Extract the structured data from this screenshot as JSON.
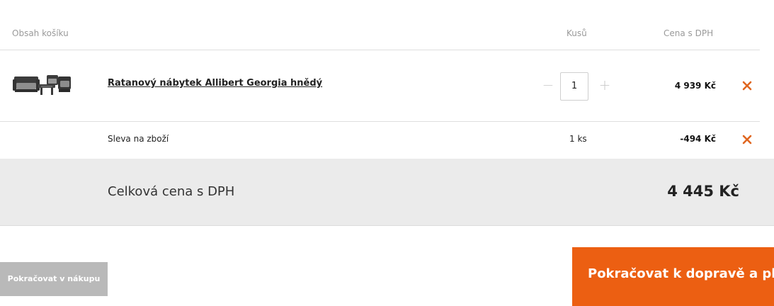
{
  "header": {
    "col_content": "Obsah košíku",
    "col_qty": "Kusů",
    "col_price": "Cena s DPH"
  },
  "item": {
    "name": "Ratanový nábytek Allibert Georgia hnědý",
    "quantity": "1",
    "minus_symbol": "−",
    "plus_symbol": "+",
    "price": "4 939 Kč",
    "image_icon": "rattan-furniture-set-thumbnail",
    "remove_icon": "close-icon"
  },
  "discount": {
    "label": "Sleva na zboží",
    "quantity": "1 ks",
    "price": "-494 Kč",
    "remove_icon": "close-icon"
  },
  "total": {
    "label": "Celková cena s DPH",
    "value": "4 445 Kč"
  },
  "buttons": {
    "continue_shopping": "Pokračovat v nákupu",
    "checkout": "Pokračovat k dopravě a platbě"
  },
  "colors": {
    "accent": "#ec5f12",
    "remove_x": "#e0661f",
    "secondary_button": "#b9b9b9",
    "total_band": "#ebebeb"
  }
}
